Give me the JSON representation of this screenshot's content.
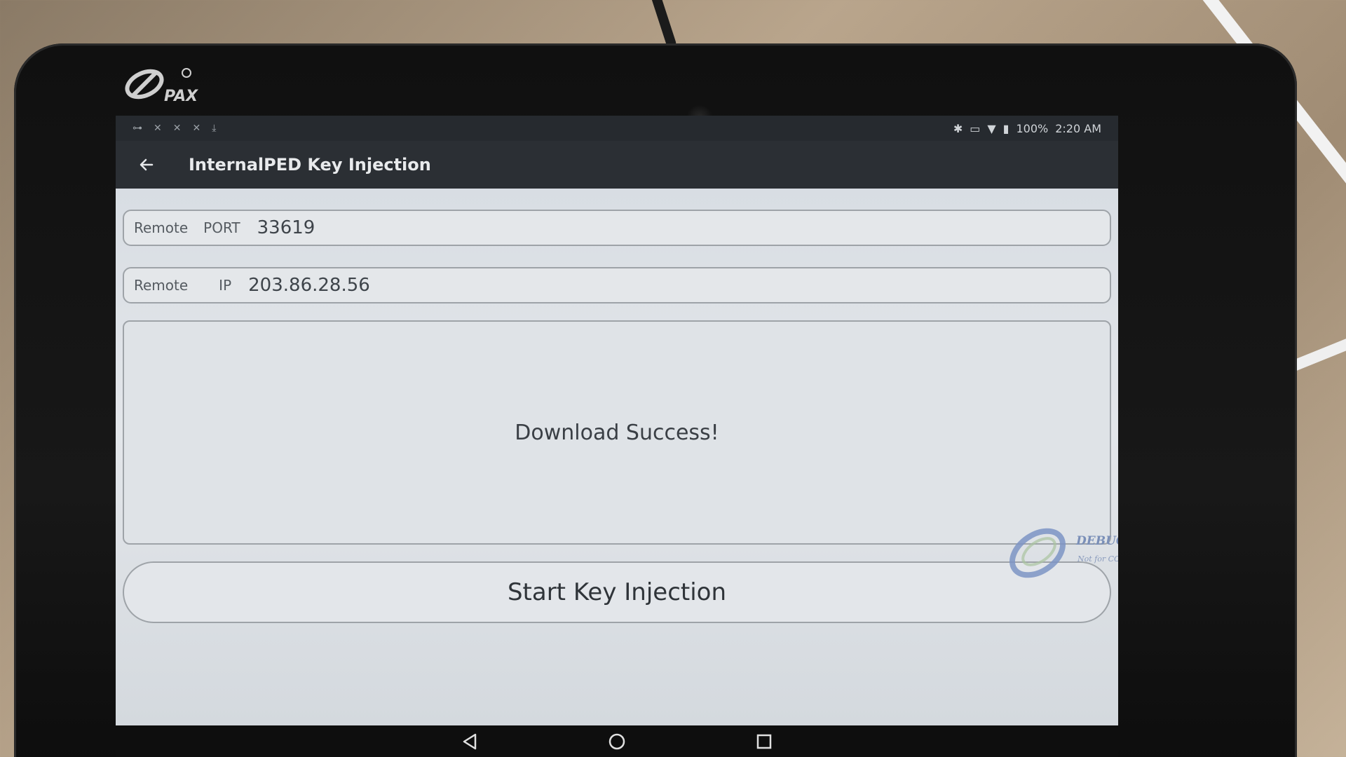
{
  "device": {
    "brand": "PAX"
  },
  "status_bar": {
    "left_icons": [
      "usb-icon",
      "notification-icon",
      "notification-icon",
      "notification-icon",
      "download-icon"
    ],
    "right_icons": [
      "bluetooth-icon",
      "cast-icon",
      "wifi-icon",
      "battery-icon"
    ],
    "battery": "100%",
    "time": "2:20 AM"
  },
  "app_bar": {
    "back_icon": "arrow-left-icon",
    "title": "InternalPED Key Injection"
  },
  "form": {
    "port": {
      "label_1": "Remote",
      "label_2": "PORT",
      "value": "33619"
    },
    "ip": {
      "label_1": "Remote",
      "label_2": "IP",
      "value": "203.86.28.56"
    }
  },
  "result": {
    "message": "Download Success!"
  },
  "actions": {
    "start_label": "Start Key Injection"
  },
  "watermark": {
    "line1": "DEBUG only",
    "line2": "Not for COMMERCIAL"
  },
  "nav_bar": {
    "icons": [
      "back-icon",
      "home-icon",
      "recents-icon"
    ]
  }
}
